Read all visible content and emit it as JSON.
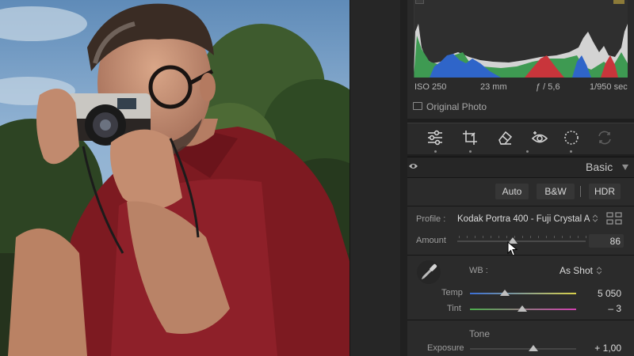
{
  "histogram": {
    "exif": {
      "iso": "ISO 250",
      "focal_length": "23 mm",
      "aperture": "ƒ / 5,6",
      "shutter": "1/950 sec"
    },
    "original_photo_label": "Original Photo"
  },
  "tools": [
    {
      "name": "edit-sliders-icon"
    },
    {
      "name": "crop-icon"
    },
    {
      "name": "eraser-icon"
    },
    {
      "name": "red-eye-icon"
    },
    {
      "name": "masking-icon"
    },
    {
      "name": "presets-icon"
    }
  ],
  "basic": {
    "title": "Basic",
    "buttons": {
      "auto": "Auto",
      "bw": "B&W",
      "hdr": "HDR"
    },
    "profile_label": "Profile :",
    "profile_value": "Kodak Portra 400 - Fuji Crystal Ar...",
    "amount_label": "Amount",
    "amount_value": "86",
    "amount_level": 0.43,
    "wb_label": "WB :",
    "wb_value": "As Shot",
    "temp_label": "Temp",
    "temp_value": "5 050",
    "temp_level": 0.33,
    "tint_label": "Tint",
    "tint_value": "– 3",
    "tint_level": 0.49,
    "tone_label": "Tone",
    "exposure_label": "Exposure",
    "exposure_value": "+ 1,00",
    "exposure_level": 0.6
  },
  "colors": {
    "panel_bg": "#2b2b2b",
    "histogram_blue": "#2f65c9",
    "histogram_red": "#c8353b",
    "histogram_green": "#3e9a52",
    "temp_gradient": [
      "#3b6fd6",
      "#d8d04a"
    ],
    "tint_gradient": [
      "#4cae4c",
      "#d040b0"
    ]
  }
}
